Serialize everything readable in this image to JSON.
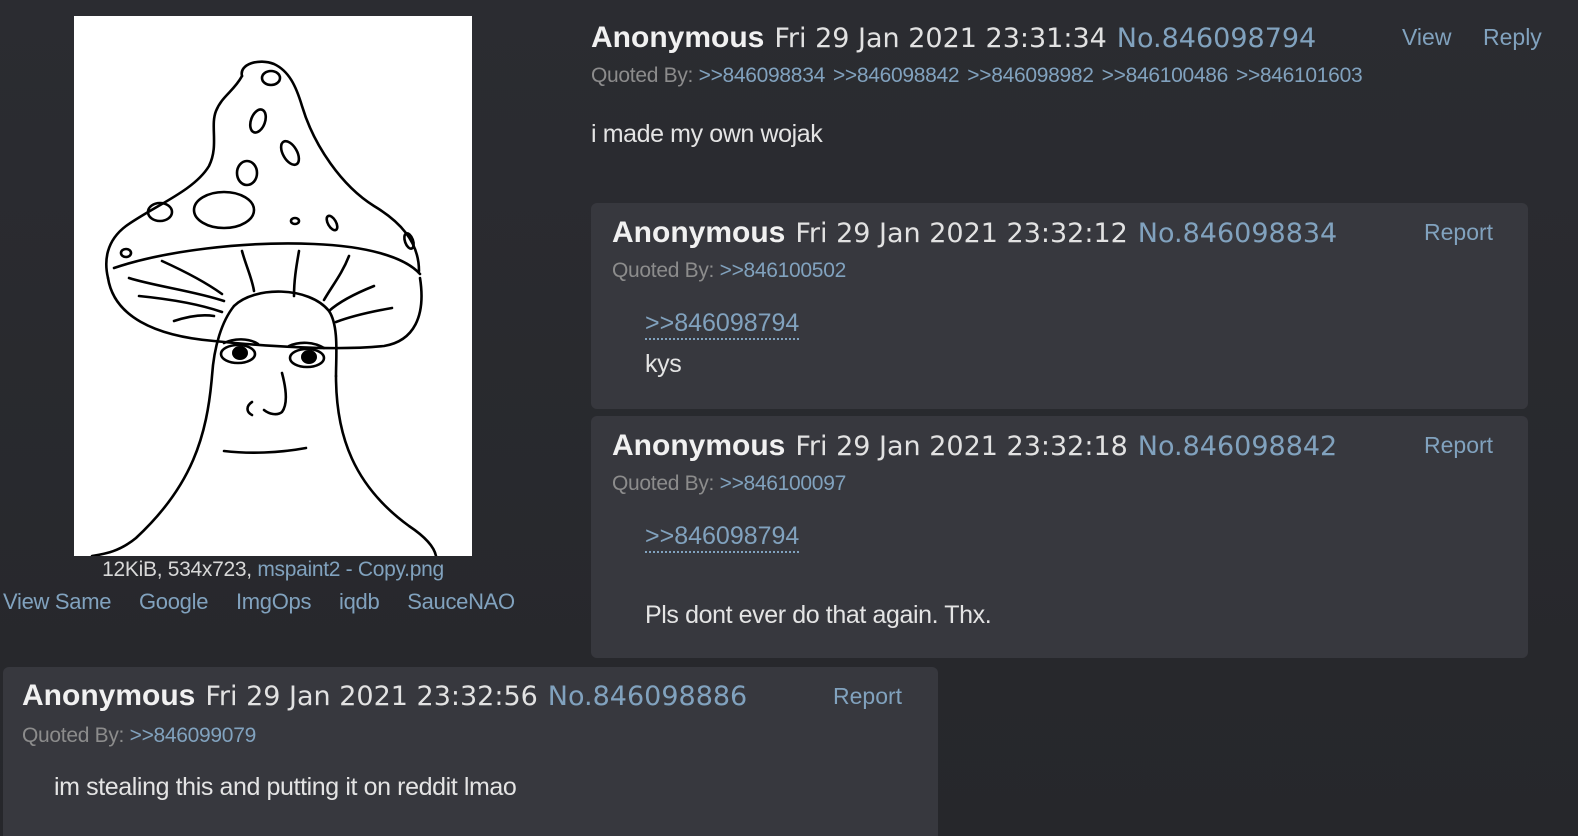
{
  "op": {
    "name": "Anonymous",
    "date": "Fri 29 Jan 2021 23:31:34",
    "post_no": "No.846098794",
    "view_label": "View",
    "reply_label": "Reply",
    "quoted_by_label": "Quoted By:",
    "quoted_by": [
      ">>846098834",
      ">>846098842",
      ">>846098982",
      ">>846100486",
      ">>846101603"
    ],
    "message": "i made my own wojak",
    "file": {
      "meta": "12KiB, 534x723,",
      "name": "mspaint2 - Copy.png"
    },
    "image_links": [
      "View Same",
      "Google",
      "ImgOps",
      "iqdb",
      "SauceNAO"
    ]
  },
  "replies": [
    {
      "name": "Anonymous",
      "date": "Fri 29 Jan 2021 23:32:12",
      "post_no": "No.846098834",
      "report_label": "Report",
      "quoted_by_label": "Quoted By:",
      "quoted_by": [
        ">>846100502"
      ],
      "quote": ">>846098794",
      "message": "kys"
    },
    {
      "name": "Anonymous",
      "date": "Fri 29 Jan 2021 23:32:18",
      "post_no": "No.846098842",
      "report_label": "Report",
      "quoted_by_label": "Quoted By:",
      "quoted_by": [
        ">>846100097"
      ],
      "quote": ">>846098794",
      "message": "Pls dont ever do that again. Thx."
    },
    {
      "name": "Anonymous",
      "date": "Fri 29 Jan 2021 23:32:56",
      "post_no": "No.846098886",
      "report_label": "Report",
      "quoted_by_label": "Quoted By:",
      "quoted_by": [
        ">>846099079"
      ],
      "message": "im stealing this and putting it on reddit lmao"
    }
  ],
  "colors": {
    "background": "#2a2b30",
    "reply_background": "#37383e",
    "link": "#81a2be",
    "name": "#f1f1f1",
    "muted": "#8c8c8c"
  }
}
